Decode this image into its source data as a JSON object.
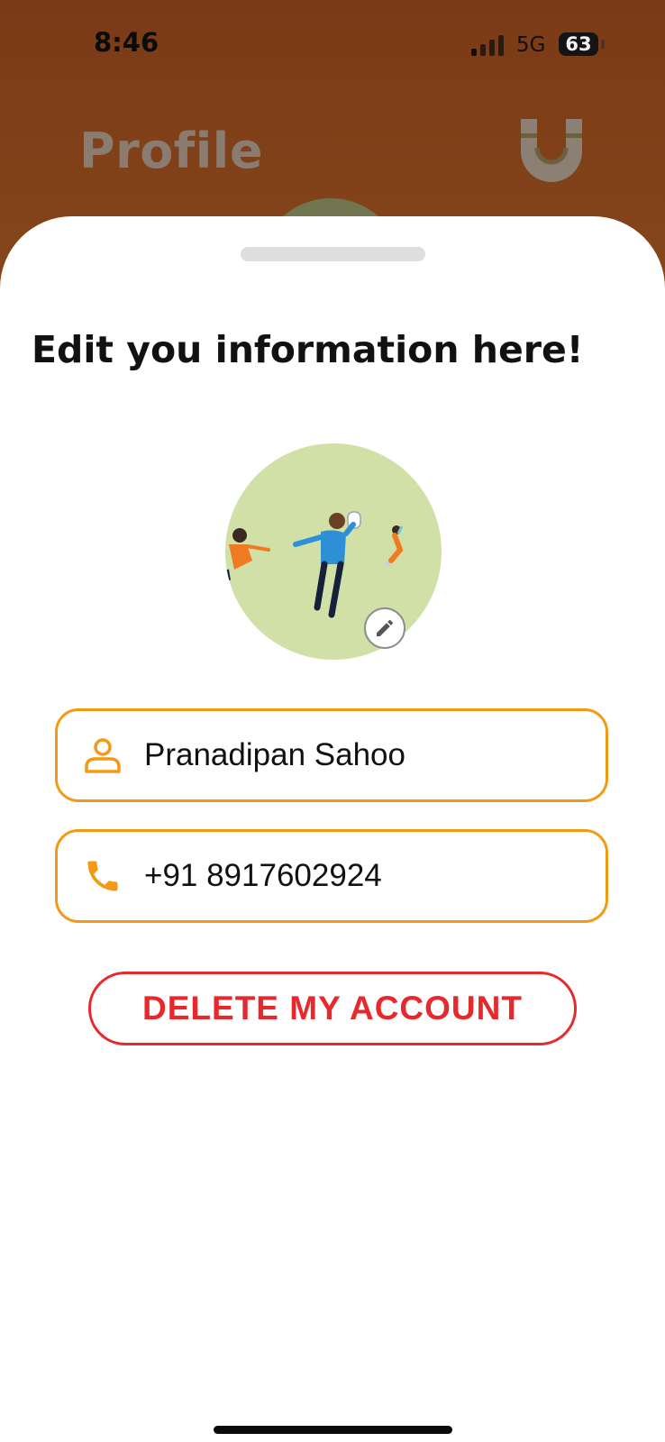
{
  "status_bar": {
    "time": "8:46",
    "network": "5G",
    "battery": "63"
  },
  "background_screen": {
    "title": "Profile",
    "logo_icon": "u-magnet-logo"
  },
  "sheet": {
    "title": "Edit you information here!",
    "avatar_image": "people-illustration",
    "edit_avatar_icon": "pencil-icon",
    "name_field": {
      "icon": "person-icon",
      "value": "Pranadipan Sahoo"
    },
    "phone_field": {
      "icon": "phone-icon",
      "value": "+91 8917602924"
    },
    "delete_button": "DELETE MY ACCOUNT"
  },
  "colors": {
    "accent": "#f29a16",
    "danger": "#e7282d",
    "avatar_bg": "#d1e0a6"
  }
}
